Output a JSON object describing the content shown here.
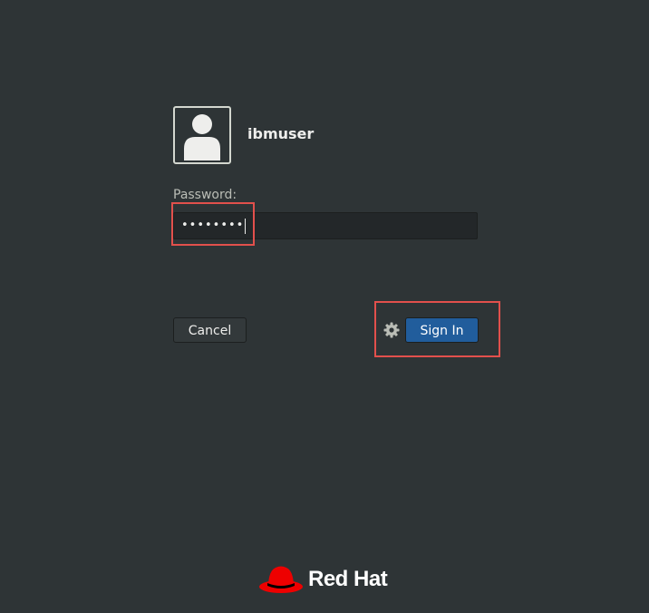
{
  "user": {
    "username": "ibmuser"
  },
  "password": {
    "label": "Password:",
    "masked_value": "••••••••"
  },
  "buttons": {
    "cancel_label": "Cancel",
    "signin_label": "Sign In"
  },
  "icons": {
    "avatar": "user-avatar-icon",
    "settings": "gear-icon",
    "logo": "redhat-logo"
  },
  "branding": {
    "logo_text": "Red Hat"
  },
  "colors": {
    "background": "#2e3436",
    "signin_button": "#215d9c",
    "highlight": "#e2504c",
    "logo_red": "#ee0000"
  }
}
